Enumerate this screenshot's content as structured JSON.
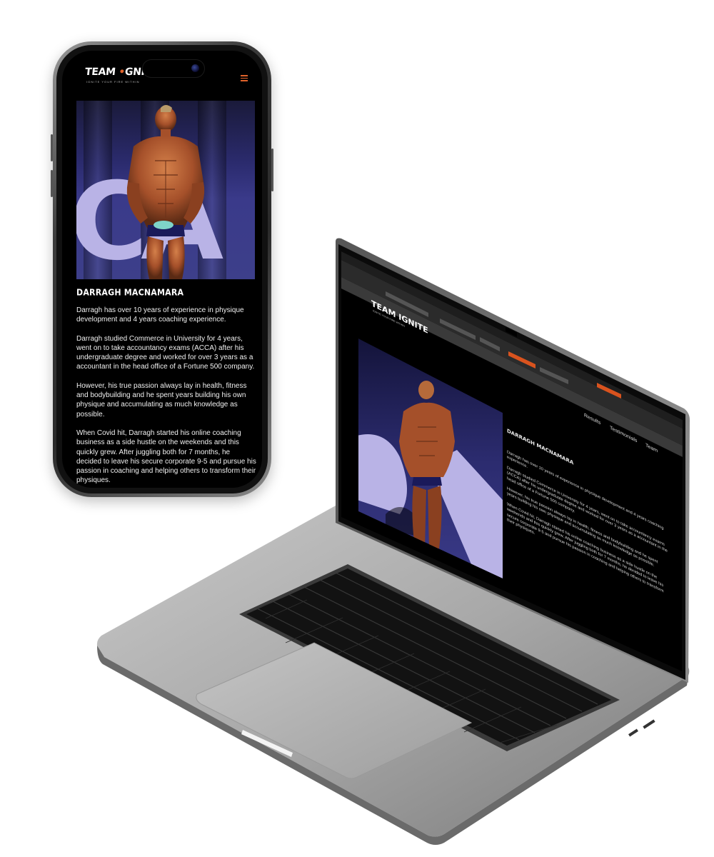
{
  "brand": {
    "logo_text": "TEAM IGNITE",
    "logo_part1": "TEAM ",
    "logo_part2": "GNITE",
    "tagline": "IGNITE YOUR FIRE WITHIN"
  },
  "profile": {
    "name": "DARRAGH MACNAMARA",
    "paragraphs": [
      "Darragh has over 10 years of experience in physique development and 4 years coaching experience.",
      "Darragh studied Commerce in University for 4 years, went on to take accountancy exams (ACCA) after his undergraduate degree and worked for over 3 years as a accountant in the head office of a Fortune 500 company.",
      "However, his true passion always lay in health, fitness and bodybuilding and he spent years building his own physique and accumulating as much knowledge as possible.",
      "When Covid hit, Darragh started his online coaching business as a side hustle on the weekends and this quickly grew. After juggling both for 7 months, he decided to leave his secure corporate 9-5 and pursue his passion in coaching and helping others to transform their physiques."
    ]
  },
  "laptop": {
    "browser_app": "Google Chrome",
    "nav_items": [
      "Results",
      "Testimonials",
      "Team"
    ]
  },
  "colors": {
    "accent": "#e0622a",
    "screen_bg": "#000000",
    "stage_purple": "#2b2b6e",
    "stage_letters": "#b9b3e6"
  }
}
